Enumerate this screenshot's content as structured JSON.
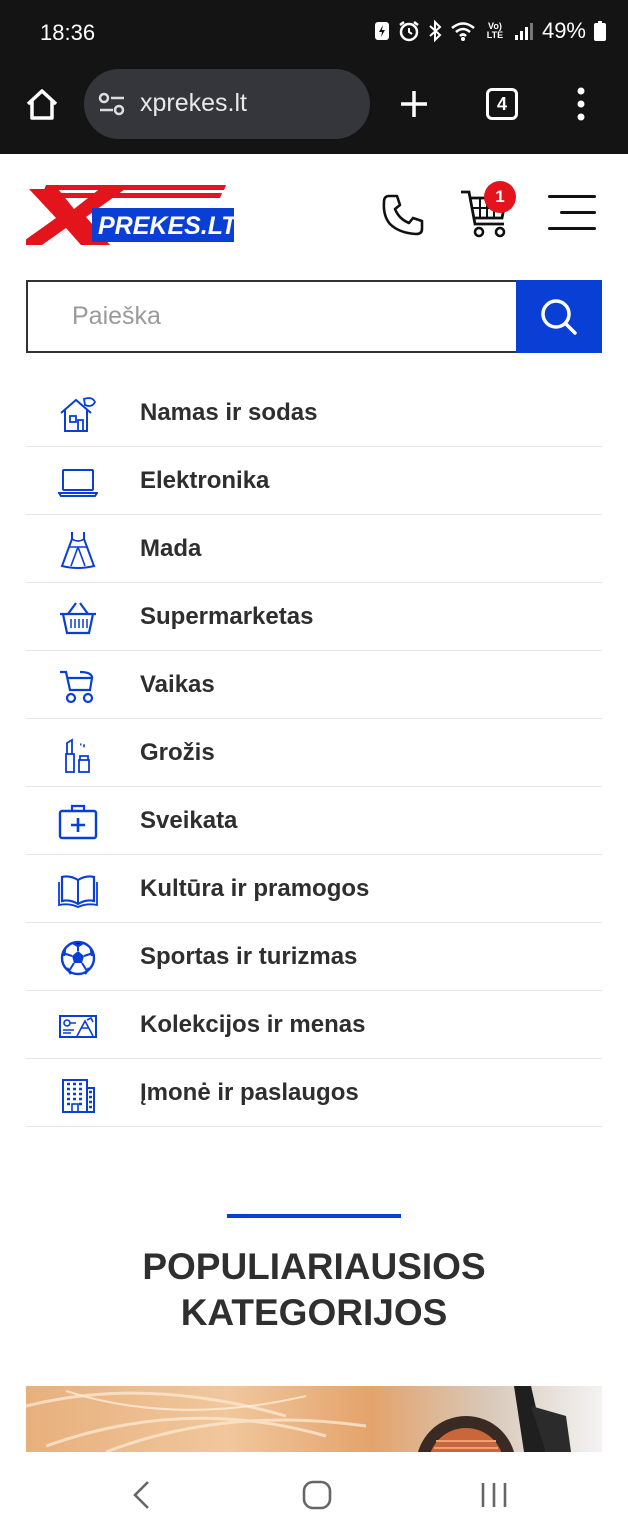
{
  "status_bar": {
    "time": "18:36",
    "battery": "49%",
    "network_badge": "Vo) LTE"
  },
  "browser": {
    "url": "xprekes.lt",
    "tab_count": "4"
  },
  "site": {
    "logo_text": "PREKES.LT",
    "cart_count": "1",
    "search_placeholder": "Paieška",
    "accent_color": "#0a3fd6",
    "badge_color": "#e3141c"
  },
  "categories": [
    {
      "label": "Namas ir sodas",
      "icon": "house-garden-icon"
    },
    {
      "label": "Elektronika",
      "icon": "laptop-icon"
    },
    {
      "label": "Mada",
      "icon": "dress-icon"
    },
    {
      "label": "Supermarketas",
      "icon": "basket-icon"
    },
    {
      "label": "Vaikas",
      "icon": "stroller-icon"
    },
    {
      "label": "Grožis",
      "icon": "lipstick-icon"
    },
    {
      "label": "Sveikata",
      "icon": "first-aid-kit-icon"
    },
    {
      "label": "Kultūra ir pramogos",
      "icon": "book-icon"
    },
    {
      "label": "Sportas ir turizmas",
      "icon": "soccer-ball-icon"
    },
    {
      "label": "Kolekcijos ir menas",
      "icon": "collection-icon"
    },
    {
      "label": "Įmonė ir paslaugos",
      "icon": "office-building-icon"
    }
  ],
  "popular": {
    "title_line1": "POPULIARIAUSIOS",
    "title_line2": "KATEGORIJOS"
  }
}
